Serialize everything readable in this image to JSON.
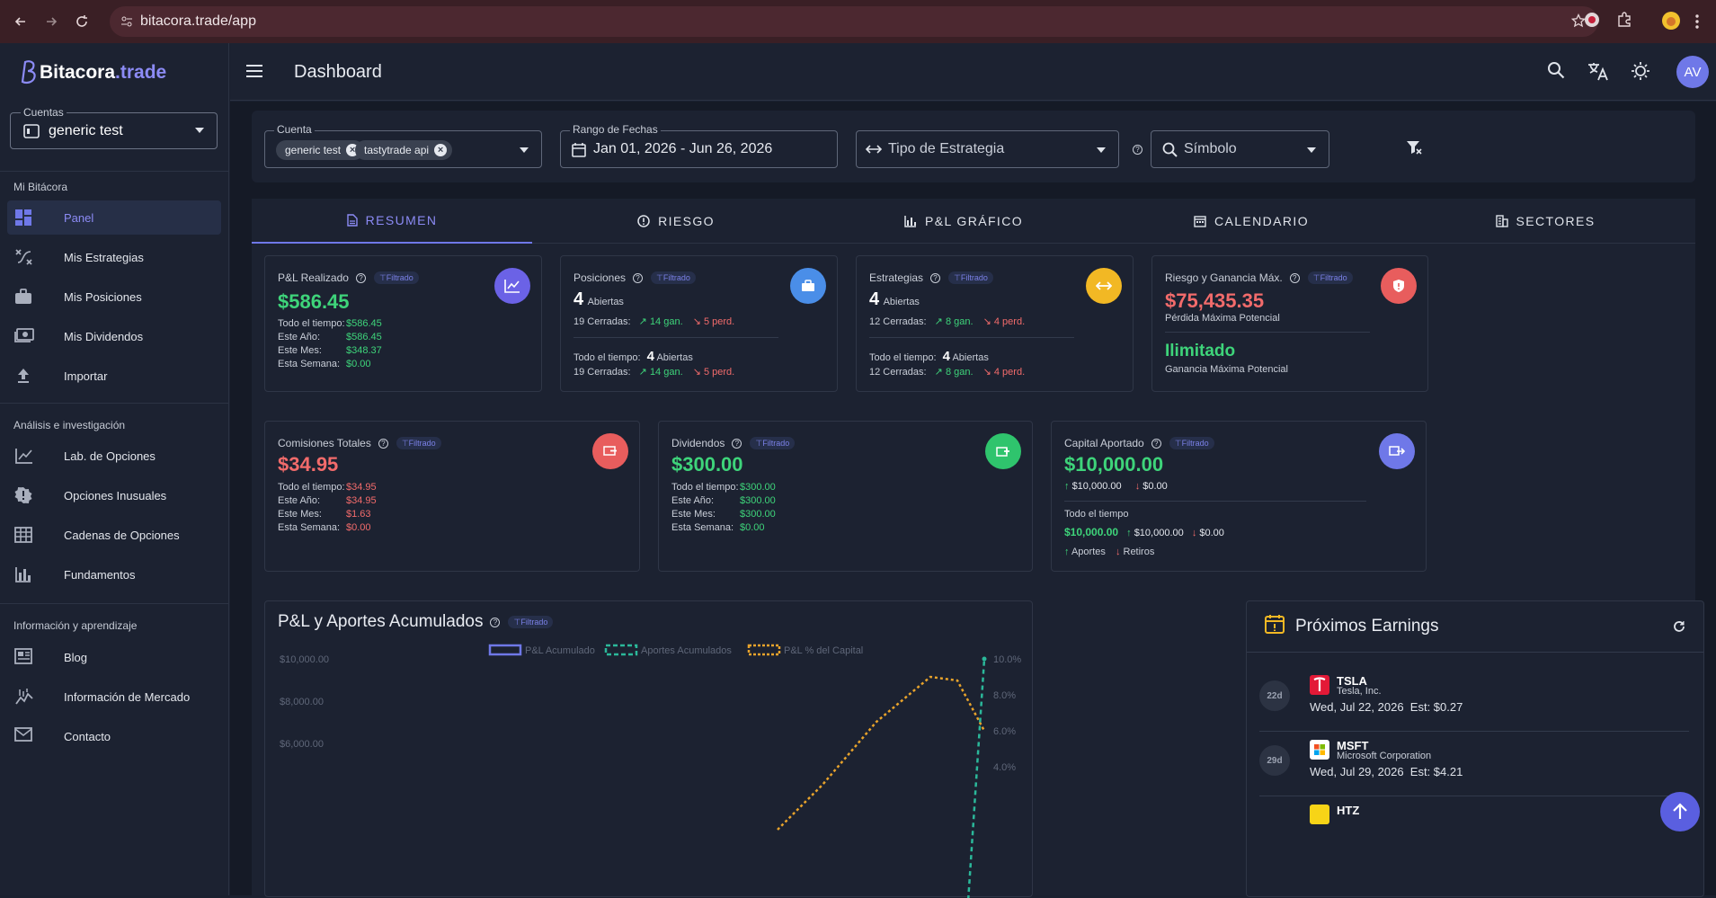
{
  "browser": {
    "url": "bitacora.trade/app"
  },
  "brand": {
    "name": "Bitacora",
    "tld": ".trade"
  },
  "sidebar": {
    "account_label": "Cuentas",
    "account_value": "generic test",
    "sections": [
      {
        "title": "Mi Bitácora",
        "items": [
          "Panel",
          "Mis Estrategias",
          "Mis Posiciones",
          "Mis Dividendos",
          "Importar"
        ]
      },
      {
        "title": "Análisis e investigación",
        "items": [
          "Lab. de Opciones",
          "Opciones Inusuales",
          "Cadenas de Opciones",
          "Fundamentos"
        ]
      },
      {
        "title": "Información y aprendizaje",
        "items": [
          "Blog",
          "Información de Mercado",
          "Contacto"
        ]
      }
    ]
  },
  "header": {
    "title": "Dashboard",
    "avatar": "AV"
  },
  "filters": {
    "account_label": "Cuenta",
    "account_chips": [
      "generic test",
      "tastytrade api"
    ],
    "date_label": "Rango de Fechas",
    "date_value": "Jan 01, 2026 - Jun 26, 2026",
    "strategy_placeholder": "Tipo de Estrategia",
    "symbol_placeholder": "Símbolo"
  },
  "tabs": [
    "RESUMEN",
    "RIESGO",
    "P&L GRÁFICO",
    "CALENDARIO",
    "SECTORES"
  ],
  "filtered_badge": "Filtrado",
  "cards": {
    "pnl": {
      "title": "P&L Realizado",
      "value": "$586.45",
      "rows": [
        [
          "Todo el tiempo:",
          "$586.45"
        ],
        [
          "Este Año:",
          "$586.45"
        ],
        [
          "Este Mes:",
          "$348.37"
        ],
        [
          "Esta Semana:",
          "$0.00"
        ]
      ]
    },
    "positions": {
      "title": "Posiciones",
      "open_count": "4",
      "open_label": "Abiertas",
      "closed": "19 Cerradas:",
      "wins": "14 gan.",
      "losses": "5 perd.",
      "all_label": "Todo el tiempo:",
      "all_open": "4",
      "all_open_label": "Abiertas",
      "all_closed": "19 Cerradas:",
      "all_wins": "14 gan.",
      "all_losses": "5 perd."
    },
    "strategies": {
      "title": "Estrategias",
      "open_count": "4",
      "open_label": "Abiertas",
      "closed": "12 Cerradas:",
      "wins": "8 gan.",
      "losses": "4 perd.",
      "all_label": "Todo el tiempo:",
      "all_open": "4",
      "all_open_label": "Abiertas",
      "all_closed": "12 Cerradas:",
      "all_wins": "8 gan.",
      "all_losses": "4 perd."
    },
    "risk": {
      "title": "Riesgo y Ganancia Máx.",
      "loss_value": "$75,435.35",
      "loss_label": "Pérdida Máxima Potencial",
      "gain_value": "Ilimitado",
      "gain_label": "Ganancia Máxima Potencial"
    },
    "commissions": {
      "title": "Comisiones Totales",
      "value": "$34.95",
      "rows": [
        [
          "Todo el tiempo:",
          "$34.95"
        ],
        [
          "Este Año:",
          "$34.95"
        ],
        [
          "Este Mes:",
          "$1.63"
        ],
        [
          "Esta Semana:",
          "$0.00"
        ]
      ]
    },
    "dividends": {
      "title": "Dividendos",
      "value": "$300.00",
      "rows": [
        [
          "Todo el tiempo:",
          "$300.00"
        ],
        [
          "Este Año:",
          "$300.00"
        ],
        [
          "Este Mes:",
          "$300.00"
        ],
        [
          "Esta Semana:",
          "$0.00"
        ]
      ]
    },
    "capital": {
      "title": "Capital Aportado",
      "value": "$10,000.00",
      "in": "$10,000.00",
      "out": "$0.00",
      "all_label": "Todo el tiempo",
      "all_value": "$10,000.00",
      "all_in": "$10,000.00",
      "all_out": "$0.00",
      "legend_in": "Aportes",
      "legend_out": "Retiros"
    }
  },
  "chart": {
    "title": "P&L y Aportes Acumulados"
  },
  "chart_data": {
    "type": "line",
    "series": [
      {
        "name": "P&L Acumulado",
        "color": "#6f78e8",
        "values": []
      },
      {
        "name": "Aportes Acumulados",
        "color": "#2bb89a",
        "values": [
          0,
          0,
          0,
          10000
        ]
      },
      {
        "name": "P&L % del Capital",
        "color": "#e8a32b",
        "values": [
          0.5,
          3.0,
          6.5,
          9.0,
          8.8,
          6.0
        ]
      }
    ],
    "y_left_ticks": [
      "$10,000.00",
      "$8,000.00",
      "$6,000.00"
    ],
    "y_right_ticks": [
      "10.0%",
      "8.0%",
      "6.0%",
      "4.0%"
    ]
  },
  "earnings": {
    "title": "Próximos Earnings",
    "items": [
      {
        "days": "22d",
        "ticker": "TSLA",
        "company": "Tesla, Inc.",
        "date": "Wed, Jul 22, 2026",
        "est": "Est: $0.27"
      },
      {
        "days": "29d",
        "ticker": "MSFT",
        "company": "Microsoft Corporation",
        "date": "Wed, Jul 29, 2026",
        "est": "Est: $4.21"
      },
      {
        "days": "",
        "ticker": "HTZ",
        "company": "",
        "date": "",
        "est": ""
      }
    ]
  }
}
